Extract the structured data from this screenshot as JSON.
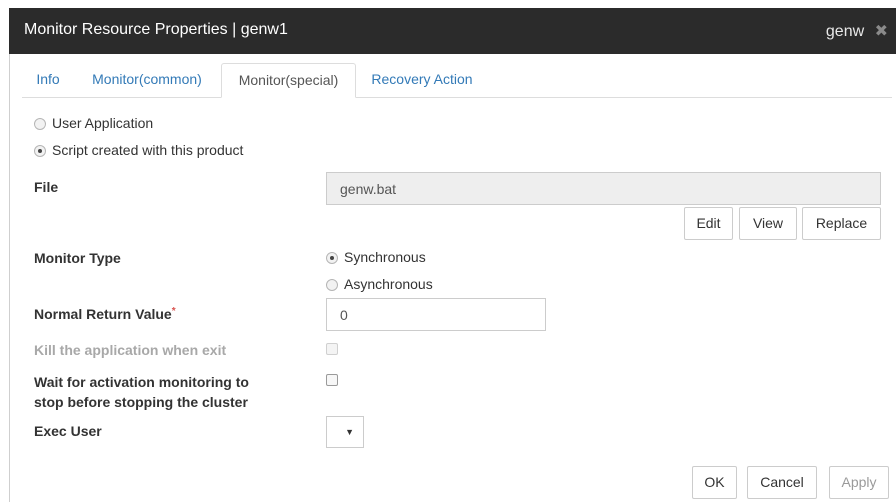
{
  "dialog": {
    "title": "Monitor Resource Properties | genw1",
    "resource_name": "genw",
    "close_glyph": "✖"
  },
  "tabs": [
    {
      "label": "Info"
    },
    {
      "label": "Monitor(common)"
    },
    {
      "label": "Monitor(special)"
    },
    {
      "label": "Recovery Action"
    }
  ],
  "active_tab": "Monitor(special)",
  "source": {
    "user_application_label": "User Application",
    "script_label": "Script created with this product",
    "selected": "Script created with this product"
  },
  "file": {
    "label": "File",
    "value": "genw.bat",
    "edit_label": "Edit",
    "view_label": "View",
    "replace_label": "Replace"
  },
  "monitor_type": {
    "label": "Monitor Type",
    "synchronous_label": "Synchronous",
    "asynchronous_label": "Asynchronous",
    "selected": "Synchronous"
  },
  "normal_return_value": {
    "label": "Normal Return Value",
    "required_mark": "*",
    "value": "0"
  },
  "kill_application": {
    "label": "Kill the application when exit",
    "checked": false,
    "disabled": true
  },
  "wait_activation": {
    "label_line1": "Wait for activation monitoring to",
    "label_line2": "stop before stopping the cluster",
    "checked": false
  },
  "exec_user": {
    "label": "Exec User",
    "value": "",
    "caret": "▼"
  },
  "footer": {
    "ok_label": "OK",
    "cancel_label": "Cancel",
    "apply_label": "Apply"
  },
  "colors": {
    "titlebar": "#2b2b2b",
    "tab_link": "#337ab7",
    "required": "#d9534f",
    "readonly_field": "#eeeeee"
  }
}
